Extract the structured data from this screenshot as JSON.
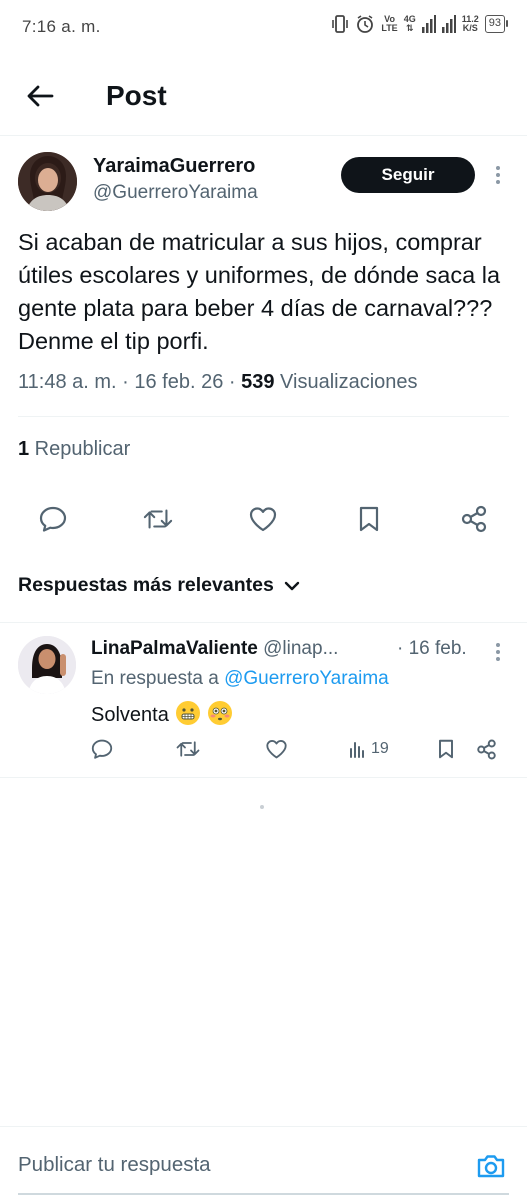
{
  "status_bar": {
    "time": "7:16 a. m.",
    "volte_top": "Vo",
    "volte_bottom": "LTE",
    "network": "4G",
    "speed_value": "11.2",
    "speed_unit": "K/S",
    "battery": "93"
  },
  "header": {
    "back_icon": "arrow-left-icon",
    "title": "Post"
  },
  "post": {
    "author_name": "YaraimaGuerrero",
    "author_handle": "@GuerreroYaraima",
    "follow_label": "Seguir",
    "text": "Si acaban de matricular a sus hijos, comprar útiles escolares y uniformes, de dónde saca la gente plata para beber 4 días de carnaval??? Denme el tip porfi.",
    "timestamp": "11:48 a. m. · 16 feb. 26 · ",
    "views_count": "539",
    "views_label": " Visualizaciones",
    "reposts_count": "1",
    "reposts_label": " Republicar",
    "actions": [
      "reply-icon",
      "repost-icon",
      "like-icon",
      "bookmark-icon",
      "share-icon"
    ]
  },
  "replies_sort": {
    "label": "Respuestas más relevantes"
  },
  "reply": {
    "author_name": "LinaPalmaValiente",
    "author_handle": " @linap...",
    "date": "· 16 feb.",
    "in_reply_prefix": "En respuesta a ",
    "in_reply_handle": "@GuerreroYaraima",
    "text": "Solventa",
    "emojis": [
      "grimacing-face-emoji",
      "flushed-face-emoji"
    ],
    "views": "19"
  },
  "compose": {
    "placeholder": "Publicar tu respuesta",
    "camera_icon": "camera-icon"
  },
  "colors": {
    "text_primary": "#0f1419",
    "text_secondary": "#536471",
    "link": "#1d9bf0",
    "follow_bg": "#0f1419"
  }
}
